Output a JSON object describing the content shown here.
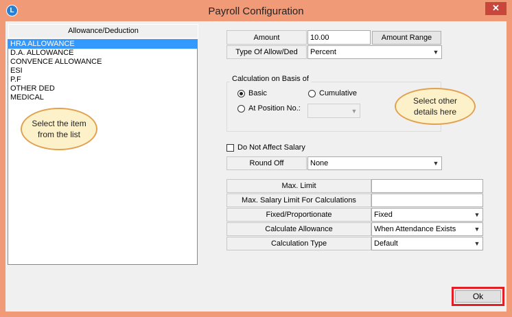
{
  "window": {
    "title": "Payroll Configuration",
    "app_icon": "L",
    "close_glyph": "✕"
  },
  "list": {
    "header": "Allowance/Deduction",
    "items": [
      "HRA ALLOWANCE",
      "D.A. ALLOWANCE",
      "CONVENCE ALLOWANCE",
      "ESI",
      "P.F",
      "OTHER DED",
      "MEDICAL"
    ],
    "selected_index": 0,
    "callout": "Select the item from the list"
  },
  "amount": {
    "label": "Amount",
    "value": "10.00",
    "range_button": "Amount Range"
  },
  "type": {
    "label": "Type Of Allow/Ded",
    "value": "Percent"
  },
  "calc_basis": {
    "title": "Calculation on Basis of",
    "basic": "Basic",
    "cumulative": "Cumulative",
    "at_position": "At Position No.:",
    "selected": "Basic"
  },
  "details_callout": "Select other details here",
  "not_affect": {
    "label": "Do Not Affect Salary",
    "checked": false
  },
  "round_off": {
    "label": "Round Off",
    "value": "None"
  },
  "limits": {
    "max_limit": {
      "label": "Max. Limit",
      "value": ""
    },
    "max_salary": {
      "label": "Max. Salary Limit For Calculations",
      "value": ""
    },
    "fixed": {
      "label": "Fixed/Proportionate",
      "value": "Fixed"
    },
    "calc_allow": {
      "label": "Calculate Allowance",
      "value": "When Attendance Exists"
    },
    "calc_type": {
      "label": "Calculation Type",
      "value": "Default"
    }
  },
  "ok_button": "Ok",
  "colors": {
    "frame": "#f19a78",
    "selection": "#3399ff",
    "highlight_box": "#e41e25",
    "callout_fill": "#fdf1c9",
    "callout_border": "#e1a151"
  }
}
